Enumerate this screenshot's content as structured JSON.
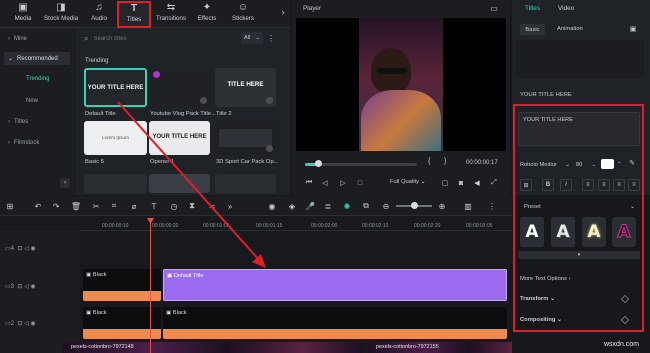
{
  "top_tabs": [
    {
      "label": "Media",
      "icon": "media-icon"
    },
    {
      "label": "Stock Media",
      "icon": "stock-media-icon"
    },
    {
      "label": "Audio",
      "icon": "audio-icon"
    },
    {
      "label": "Titles",
      "icon": "titles-icon",
      "active": true
    },
    {
      "label": "Transitions",
      "icon": "transitions-icon"
    },
    {
      "label": "Effects",
      "icon": "effects-icon"
    },
    {
      "label": "Stickers",
      "icon": "stickers-icon"
    }
  ],
  "sidebar": {
    "items": [
      "Mine",
      "Recommended",
      "Trending",
      "New",
      "Titles",
      "Filmstock"
    ]
  },
  "search": {
    "placeholder": "Search titles",
    "filter_value": "All"
  },
  "library": {
    "section_label": "Trending",
    "cards": [
      {
        "thumb_text": "YOUR TITLE HERE",
        "caption": "Default Title"
      },
      {
        "thumb_text": "",
        "caption": "Youtube Vlog Pack Title..."
      },
      {
        "thumb_text": "TITLE HERE",
        "caption": "Title 2"
      },
      {
        "thumb_text": "Lorem Ipsum",
        "caption": "Basic 6"
      },
      {
        "thumb_text": "YOUR TITLE HERE",
        "caption": "Opener 1"
      },
      {
        "thumb_text": "",
        "caption": "3D Sport Car Pack Op..."
      }
    ]
  },
  "player": {
    "title": "Player",
    "timecode": "00:00:00:17",
    "quality": "Full Quality"
  },
  "right_panel": {
    "tabs": [
      "Titles",
      "Video"
    ],
    "subtabs": [
      "Basic",
      "Animation"
    ],
    "section_title": "YOUR TITLE HERE",
    "text_value": "YOUR TITLE HERE",
    "font": "Roboto Mediur",
    "size": "80",
    "preset_label": "Preset",
    "preset_letters": [
      "A",
      "A",
      "A",
      "A"
    ],
    "more_text_options": "More Text Options",
    "transform": "Transform",
    "compositing": "Compositing",
    "accent_color": "#e01e2b"
  },
  "timeline": {
    "ruler": [
      "00:00:00:10",
      "00:00:00:20",
      "00:00:01:05",
      "00:00:01:15",
      "00:00:02:00",
      "00:00:02:10",
      "00:00:02:20",
      "00:00:03:05"
    ],
    "tracks": [
      {
        "index": "4"
      },
      {
        "index": "3"
      },
      {
        "index": "2"
      },
      {
        "index": "1"
      }
    ],
    "clips": {
      "black1": "Black",
      "default_title": "Default Title",
      "black2": "Black",
      "black3": "Black",
      "video1": "pexels-cottonbro-7972148",
      "video2": "pexels-cottonbro-7972155"
    }
  },
  "watermark": "wsxdn.com"
}
